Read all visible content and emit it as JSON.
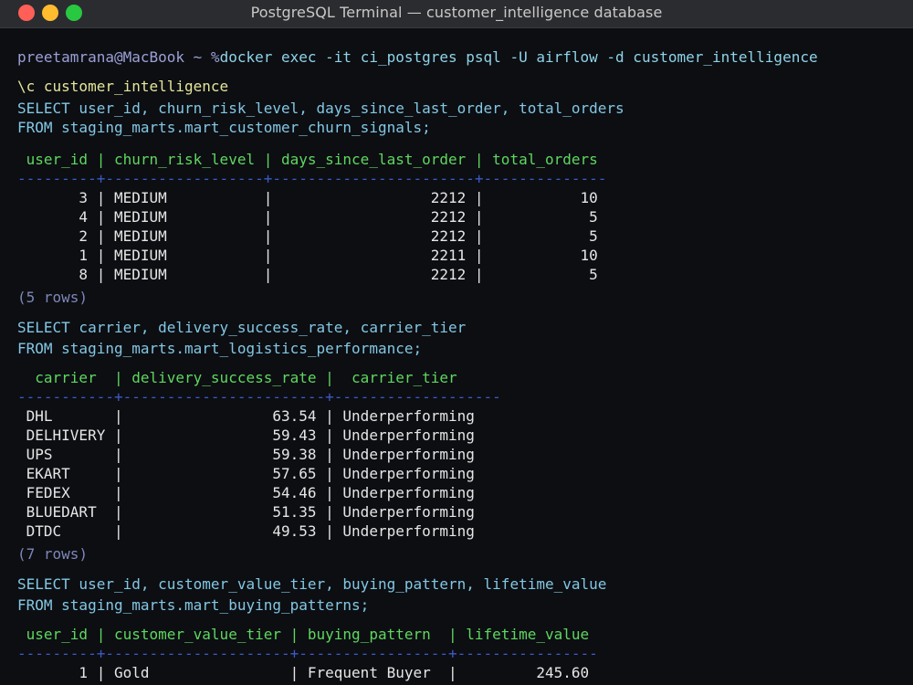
{
  "window": {
    "title": "PostgreSQL Terminal — customer_intelligence database"
  },
  "prompt": {
    "user_host": "preetamrana@MacBook ~ %",
    "command": "docker exec -it ci_postgres psql -U airflow -d customer_intelligence"
  },
  "connect_cmd": "\\c customer_intelligence",
  "query1": {
    "select": "SELECT user_id, churn_risk_level, days_since_last_order, total_orders",
    "from": "FROM staging_marts.mart_customer_churn_signals;",
    "header": " user_id | churn_risk_level | days_since_last_order | total_orders",
    "separator": "---------+------------------+-----------------------+--------------",
    "rows": [
      "       3 | MEDIUM           |                  2212 |           10",
      "       4 | MEDIUM           |                  2212 |            5",
      "       2 | MEDIUM           |                  2212 |            5",
      "       1 | MEDIUM           |                  2211 |           10",
      "       8 | MEDIUM           |                  2212 |            5"
    ],
    "row_count": "(5 rows)"
  },
  "query2": {
    "select": "SELECT carrier, delivery_success_rate, carrier_tier",
    "from": "FROM staging_marts.mart_logistics_performance;",
    "header": "  carrier  | delivery_success_rate |  carrier_tier",
    "separator": "-----------+-----------------------+-------------------",
    "rows": [
      " DHL       |                 63.54 | Underperforming",
      " DELHIVERY |                 59.43 | Underperforming",
      " UPS       |                 59.38 | Underperforming",
      " EKART     |                 57.65 | Underperforming",
      " FEDEX     |                 54.46 | Underperforming",
      " BLUEDART  |                 51.35 | Underperforming",
      " DTDC      |                 49.53 | Underperforming"
    ],
    "row_count": "(7 rows)"
  },
  "query3": {
    "select": "SELECT user_id, customer_value_tier, buying_pattern, lifetime_value",
    "from": "FROM staging_marts.mart_buying_patterns;",
    "header": " user_id | customer_value_tier | buying_pattern  | lifetime_value",
    "separator": "---------+---------------------+-----------------+----------------",
    "rows": [
      "       1 | Gold                | Frequent Buyer  |         245.60"
    ]
  },
  "colors": {
    "traffic_close": "#ff5f57",
    "traffic_minimize": "#febc2e",
    "traffic_maximize": "#28c840",
    "header_text": "#5fd75f",
    "separator": "#3d5ac8",
    "sql_text": "#83c7e4"
  }
}
